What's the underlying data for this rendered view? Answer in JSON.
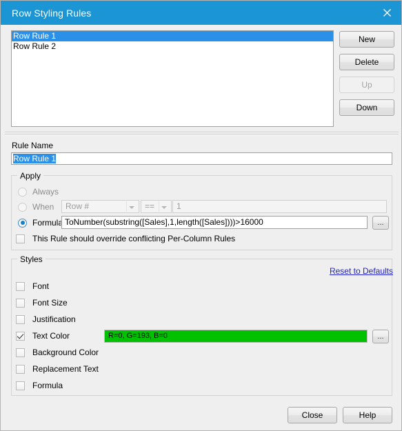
{
  "window": {
    "title": "Row Styling Rules",
    "titlebar_color": "#1c95d4",
    "close_icon": "close-icon"
  },
  "rules_list": {
    "items": [
      {
        "label": "Row Rule 1",
        "selected": true
      },
      {
        "label": "Row Rule 2",
        "selected": false
      }
    ]
  },
  "side_buttons": [
    {
      "label": "New",
      "enabled": true
    },
    {
      "label": "Delete",
      "enabled": true
    },
    {
      "label": "Up",
      "enabled": false
    },
    {
      "label": "Down",
      "enabled": true
    }
  ],
  "rule_name": {
    "label": "Rule Name",
    "value": "Row Rule 1",
    "selected": true
  },
  "apply": {
    "legend": "Apply",
    "options": [
      {
        "label": "Always",
        "checked": false,
        "enabled": false
      },
      {
        "label": "When",
        "checked": false,
        "enabled": false
      },
      {
        "label": "Formula",
        "checked": true,
        "enabled": true
      }
    ],
    "when_field": "Row #",
    "when_operator": "==",
    "when_value": "1",
    "formula_value": "ToNumber(substring([Sales],1,length([Sales])))>16000",
    "formula_browse_label": "...",
    "override_checkbox": {
      "label": "This Rule should override conflicting Per-Column Rules",
      "checked": false
    }
  },
  "styles": {
    "legend": "Styles",
    "reset_link": "Reset to Defaults",
    "items": [
      {
        "label": "Font",
        "checked": false
      },
      {
        "label": "Font Size",
        "checked": false
      },
      {
        "label": "Justification",
        "checked": false
      },
      {
        "label": "Text Color",
        "checked": true
      },
      {
        "label": "Background Color",
        "checked": false
      },
      {
        "label": "Replacement Text",
        "checked": false
      },
      {
        "label": "Formula",
        "checked": false
      }
    ],
    "text_color": {
      "value": "R=0, G=193, B=0",
      "hex": "#00c100",
      "browse_label": "..."
    }
  },
  "footer": {
    "close_label": "Close",
    "help_label": "Help"
  }
}
